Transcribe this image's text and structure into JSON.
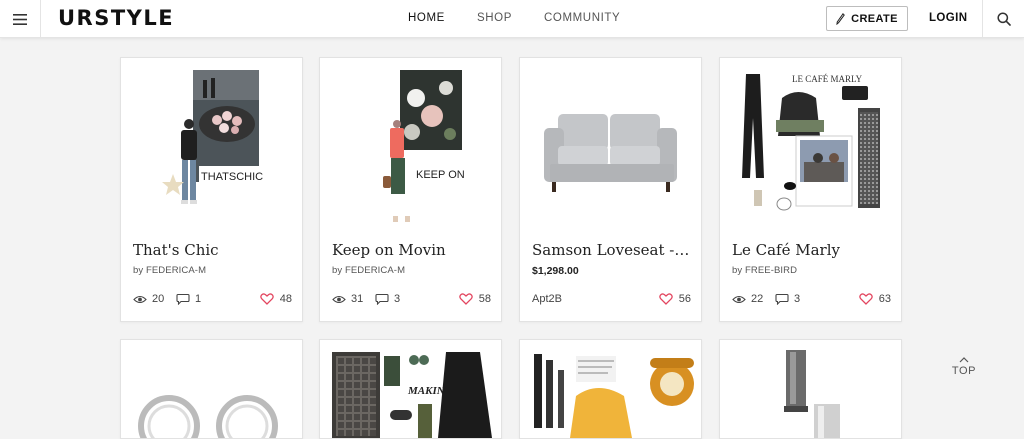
{
  "header": {
    "logo": "URSTYLE",
    "nav": [
      {
        "label": "HOME",
        "active": true
      },
      {
        "label": "SHOP",
        "active": false
      },
      {
        "label": "COMMUNITY",
        "active": false
      }
    ],
    "create_label": "CREATE",
    "login_label": "LOGIN"
  },
  "cards": [
    {
      "title": "That's Chic",
      "byline": "by FEDERICA-M",
      "views": "20",
      "comments": "1",
      "likes": "48",
      "thumb_text": "THATSCHIC"
    },
    {
      "title": "Keep on Movin",
      "byline": "by FEDERICA-M",
      "views": "31",
      "comments": "3",
      "likes": "58",
      "thumb_text": "KEEP ON"
    },
    {
      "title": "Samson Loveseat - L...",
      "price": "$1,298.00",
      "brand": "Apt2B",
      "likes": "56"
    },
    {
      "title": "Le Café Marly",
      "byline": "by FREE-BIRD",
      "views": "22",
      "comments": "3",
      "likes": "63",
      "thumb_text": "LE CAFÉ MARLY"
    }
  ],
  "row2_thumb_text": "MAKING",
  "top_label": "TOP",
  "colors": {
    "heart": "#e3455f",
    "page_bg": "#f3f3f3"
  }
}
